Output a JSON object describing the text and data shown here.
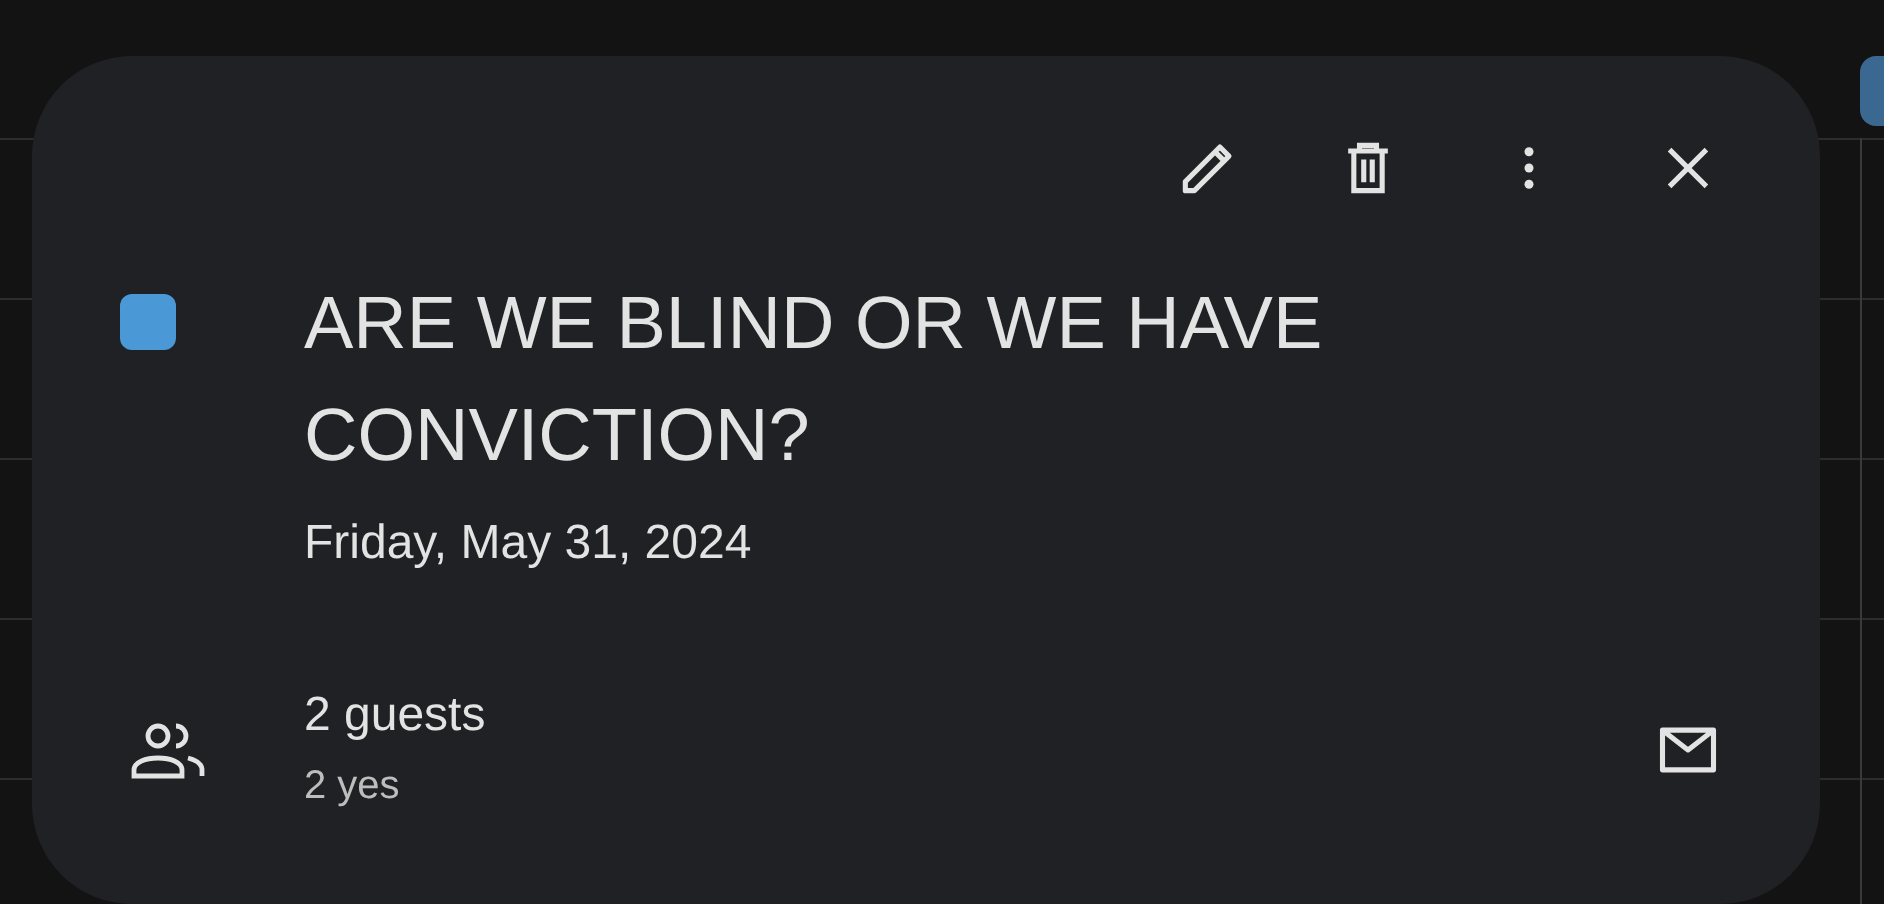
{
  "event": {
    "title": "ARE WE BLIND OR WE HAVE CONVICTION?",
    "color": "#4a98d6",
    "date": "Friday, May 31, 2024"
  },
  "guests": {
    "count": "2 guests",
    "summary": "2 yes"
  }
}
